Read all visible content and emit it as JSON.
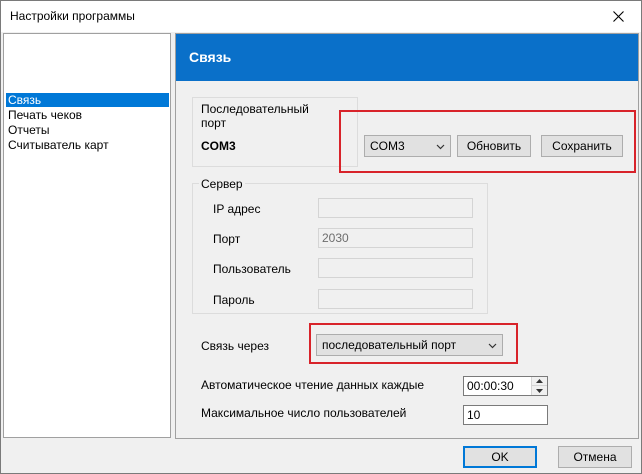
{
  "window": {
    "title": "Настройки программы"
  },
  "sidebar": {
    "items": [
      {
        "label": "Связь",
        "selected": true
      },
      {
        "label": "Печать чеков",
        "selected": false
      },
      {
        "label": "Отчеты",
        "selected": false
      },
      {
        "label": "Считыватель карт",
        "selected": false
      }
    ]
  },
  "panel": {
    "title": "Связь"
  },
  "serial": {
    "group_label": "Последовательный порт",
    "current_port": "COM3",
    "port_select_value": "COM3",
    "refresh_label": "Обновить",
    "save_label": "Сохранить"
  },
  "server": {
    "group_label": "Сервер",
    "ip_label": "IP адрес",
    "ip_value": "",
    "port_label": "Порт",
    "port_value": "2030",
    "user_label": "Пользователь",
    "user_value": "",
    "password_label": "Пароль",
    "password_value": ""
  },
  "connection": {
    "via_label": "Связь через",
    "via_value": "последовательный порт"
  },
  "auto_read": {
    "label": "Автоматическое чтение данных  каждые",
    "value": "00:00:30"
  },
  "max_users": {
    "label": "Максимальное число пользователей",
    "value": "10"
  },
  "footer": {
    "ok_label": "OK",
    "cancel_label": "Отмена"
  },
  "colors": {
    "header_blue": "#0a70c9",
    "selection_blue": "#0078d7",
    "highlight_red": "#d8232a"
  }
}
